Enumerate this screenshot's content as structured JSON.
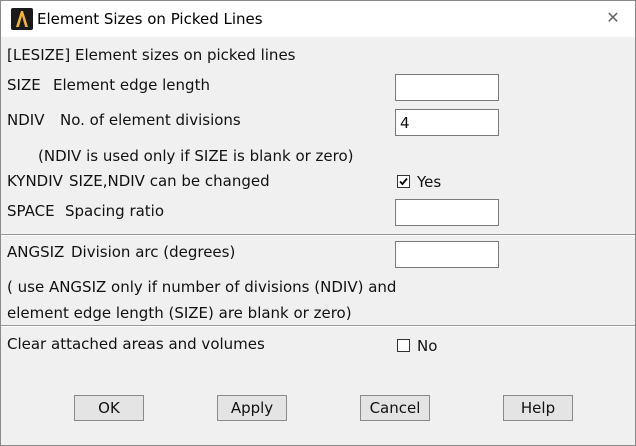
{
  "window": {
    "title": "Element Sizes on Picked Lines",
    "close_glyph": "✕"
  },
  "header_line": "[LESIZE]  Element sizes on picked lines",
  "fields": {
    "size": {
      "code": "SIZE",
      "label": "Element edge length",
      "value": ""
    },
    "ndiv": {
      "code": "NDIV",
      "label": "No. of element divisions",
      "value": "4"
    },
    "ndiv_note": "(NDIV is used only if SIZE is blank or zero)",
    "kyndiv": {
      "code": "KYNDIV",
      "label": "SIZE,NDIV can be changed",
      "checked": true,
      "state_text": "Yes"
    },
    "space": {
      "code": "SPACE",
      "label": "Spacing ratio",
      "value": ""
    },
    "angsiz": {
      "code": "ANGSIZ",
      "label": "Division arc (degrees)",
      "value": ""
    },
    "angsiz_note_1": "( use ANGSIZ only if number of divisions (NDIV) and",
    "angsiz_note_2": "element edge length (SIZE) are blank or zero)",
    "clear": {
      "label": "Clear attached areas and volumes",
      "checked": false,
      "state_text": "No"
    }
  },
  "buttons": {
    "ok": "OK",
    "apply": "Apply",
    "cancel": "Cancel",
    "help": "Help"
  },
  "colors": {
    "dialog_bg": "#f0f0f0",
    "titlebar_bg": "#ffffff",
    "app_icon_bg": "#1a1a1a",
    "app_icon_glyph": "#f2b533"
  },
  "icons": {
    "app": "ansys-logo-icon",
    "close": "close-icon",
    "check": "checkmark-icon"
  }
}
